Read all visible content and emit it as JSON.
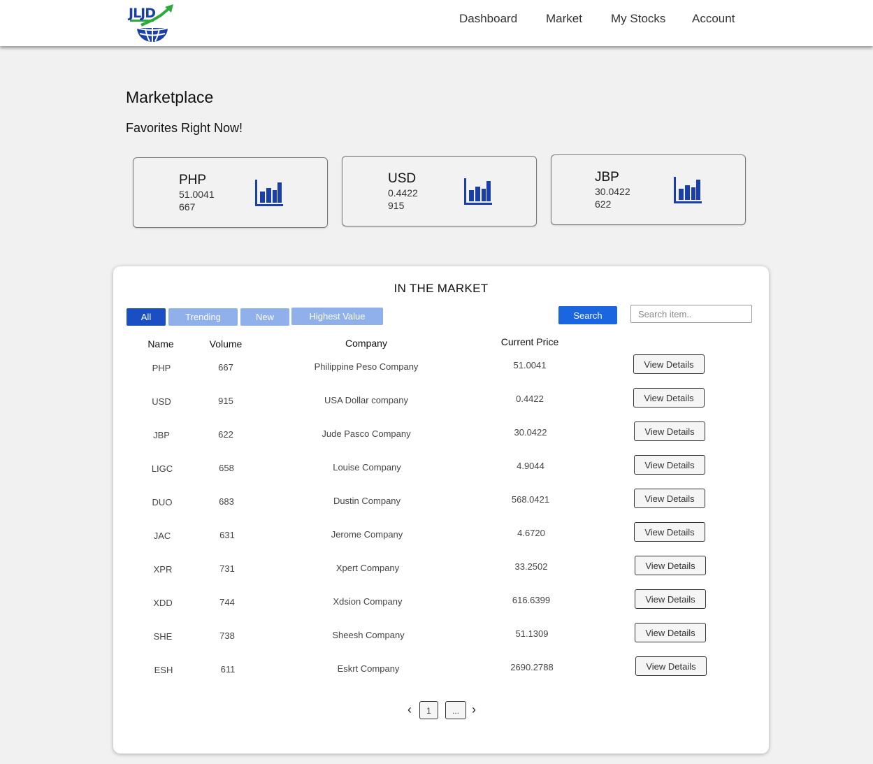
{
  "header": {
    "logo_text": "JLJD",
    "nav": [
      "Dashboard",
      "Market",
      "My Stocks",
      "Account"
    ]
  },
  "page": {
    "title": "Marketplace",
    "favorites_title": "Favorites Right Now!"
  },
  "favorites": [
    {
      "symbol": "PHP",
      "price": "51.0041",
      "volume": "667",
      "icon": "bar-chart-icon"
    },
    {
      "symbol": "USD",
      "price": "0.4422",
      "volume": "915",
      "icon": "bar-chart-icon"
    },
    {
      "symbol": "JBP",
      "price": "30.0422",
      "volume": "622",
      "icon": "bar-chart-icon"
    }
  ],
  "market": {
    "title": "IN THE MARKET",
    "filters": [
      {
        "label": "All",
        "active": true
      },
      {
        "label": "Trending",
        "active": false
      },
      {
        "label": "New",
        "active": false
      },
      {
        "label": "Highest Value",
        "active": false
      }
    ],
    "search_label": "Search",
    "search_placeholder": "Search item..",
    "columns": [
      "Name",
      "Volume",
      "Company",
      "Current Price"
    ],
    "view_label": "View Details",
    "rows": [
      {
        "name": "PHP",
        "volume": "667",
        "company": "Philippine Peso Company",
        "price": "51.0041"
      },
      {
        "name": "USD",
        "volume": "915",
        "company": "USA Dollar company",
        "price": "0.4422"
      },
      {
        "name": "JBP",
        "volume": "622",
        "company": "Jude Pasco Company",
        "price": "30.0422"
      },
      {
        "name": "LIGC",
        "volume": "658",
        "company": "Louise Company",
        "price": "4.9044"
      },
      {
        "name": "DUO",
        "volume": "683",
        "company": "Dustin Company",
        "price": "568.0421"
      },
      {
        "name": "JAC",
        "volume": "631",
        "company": "Jerome Company",
        "price": "4.6720"
      },
      {
        "name": "XPR",
        "volume": "731",
        "company": "Xpert Company",
        "price": "33.2502"
      },
      {
        "name": "XDD",
        "volume": "744",
        "company": "Xdsion Company",
        "price": "616.6399"
      },
      {
        "name": "SHE",
        "volume": "738",
        "company": "Sheesh Company",
        "price": "51.1309"
      },
      {
        "name": "ESH",
        "volume": "611",
        "company": "Eskrt Company",
        "price": "2690.2788"
      }
    ],
    "pagination": {
      "prev": "‹",
      "next": "›",
      "pages": [
        "1",
        "..."
      ]
    }
  },
  "colors": {
    "accent": "#1a4fc4",
    "accent_light": "#8fb0ea",
    "search_button": "#1a66e0",
    "chart_icon": "#1a3fa8"
  }
}
